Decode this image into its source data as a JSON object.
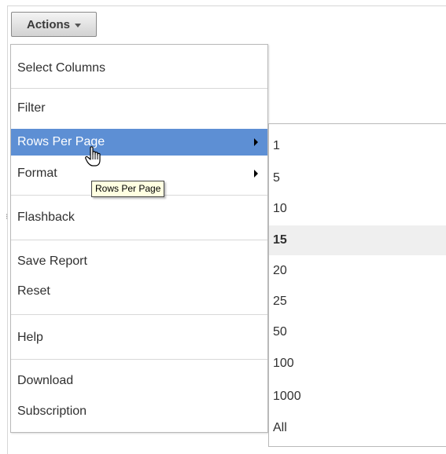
{
  "actions_button": {
    "label": "Actions",
    "icon": "chevron-down-icon"
  },
  "menu": {
    "items": [
      {
        "label": "Select Columns",
        "has_submenu": false
      },
      {
        "label": "Filter",
        "has_submenu": false
      },
      {
        "label": "Rows Per Page",
        "has_submenu": true,
        "active": true
      },
      {
        "label": "Format",
        "has_submenu": true
      },
      {
        "label": "Flashback",
        "has_submenu": false
      },
      {
        "label": "Save Report",
        "has_submenu": false
      },
      {
        "label": "Reset",
        "has_submenu": false
      },
      {
        "label": "Help",
        "has_submenu": false
      },
      {
        "label": "Download",
        "has_submenu": false
      },
      {
        "label": "Subscription",
        "has_submenu": false
      }
    ]
  },
  "rows_per_page_submenu": {
    "options": [
      "1",
      "5",
      "10",
      "15",
      "20",
      "25",
      "50",
      "100",
      "1000",
      "All"
    ],
    "selected": "15"
  },
  "tooltip": {
    "text": "Rows Per Page"
  },
  "colors": {
    "active_item_bg": "#5d8fd4",
    "selected_option_bg": "#efefef",
    "tooltip_bg": "#ffffe1"
  }
}
